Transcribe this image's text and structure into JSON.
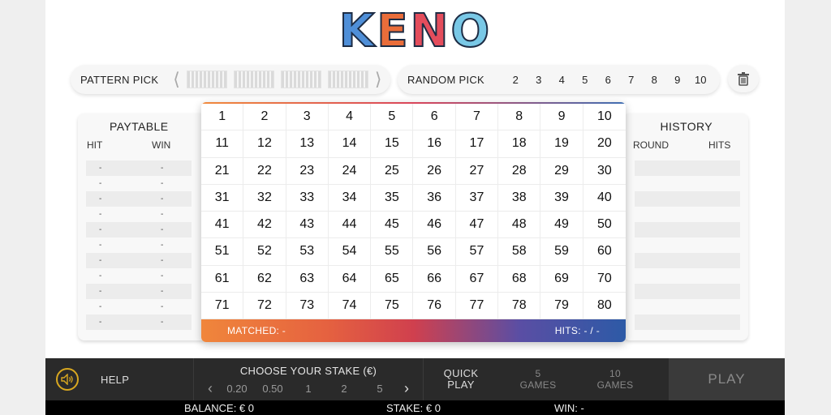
{
  "logo": {
    "letters": [
      "K",
      "E",
      "N",
      "O"
    ]
  },
  "pattern_pick": {
    "label": "PATTERN PICK",
    "prev_glyph": "⟨",
    "next_glyph": "⟩",
    "patterns": [
      "pattern-1",
      "pattern-2",
      "pattern-3",
      "pattern-4"
    ]
  },
  "random_pick": {
    "label": "RANDOM PICK",
    "options": [
      "2",
      "3",
      "4",
      "5",
      "6",
      "7",
      "8",
      "9",
      "10"
    ]
  },
  "trash": {
    "icon": "trash-icon"
  },
  "paytable": {
    "title": "PAYTABLE",
    "col_hit": "HIT",
    "col_win": "WIN",
    "rows": [
      [
        "-",
        "-"
      ],
      [
        "-",
        "-"
      ],
      [
        "-",
        "-"
      ],
      [
        "-",
        "-"
      ],
      [
        "-",
        "-"
      ],
      [
        "-",
        "-"
      ],
      [
        "-",
        "-"
      ],
      [
        "-",
        "-"
      ],
      [
        "-",
        "-"
      ],
      [
        "-",
        "-"
      ],
      [
        "-",
        "-"
      ]
    ]
  },
  "history": {
    "title": "HISTORY",
    "col_round": "ROUND",
    "col_hits": "HITS",
    "row_count": 11
  },
  "grid": {
    "numbers": [
      "1",
      "2",
      "3",
      "4",
      "5",
      "6",
      "7",
      "8",
      "9",
      "10",
      "11",
      "12",
      "13",
      "14",
      "15",
      "16",
      "17",
      "18",
      "19",
      "20",
      "21",
      "22",
      "23",
      "24",
      "25",
      "26",
      "27",
      "28",
      "29",
      "30",
      "31",
      "32",
      "33",
      "34",
      "35",
      "36",
      "37",
      "38",
      "39",
      "40",
      "41",
      "42",
      "43",
      "44",
      "45",
      "46",
      "47",
      "48",
      "49",
      "50",
      "51",
      "52",
      "53",
      "54",
      "55",
      "56",
      "57",
      "58",
      "59",
      "60",
      "61",
      "62",
      "63",
      "64",
      "65",
      "66",
      "67",
      "68",
      "69",
      "70",
      "71",
      "72",
      "73",
      "74",
      "75",
      "76",
      "77",
      "78",
      "79",
      "80"
    ],
    "matched": "MATCHED: -",
    "hits": "HITS: - / -"
  },
  "controls": {
    "sound_icon": "speaker-icon",
    "help": "HELP",
    "stake_title": "CHOOSE YOUR STAKE (€)",
    "stake_prev": "‹",
    "stake_next": "›",
    "stake_options": [
      "0.20",
      "0.50",
      "1",
      "2",
      "5"
    ],
    "quick_play": [
      "QUICK",
      "PLAY"
    ],
    "five_games": [
      "5",
      "GAMES"
    ],
    "ten_games": [
      "10",
      "GAMES"
    ],
    "play": "PLAY"
  },
  "status": {
    "balance": "BALANCE: € 0",
    "stake": "STAKE: € 0",
    "win": "WIN: -"
  },
  "colors": {
    "accent_orange": "#f0863b",
    "accent_red": "#d0404e",
    "accent_blue": "#2d5aa6",
    "sound_ring": "#d9a820"
  }
}
